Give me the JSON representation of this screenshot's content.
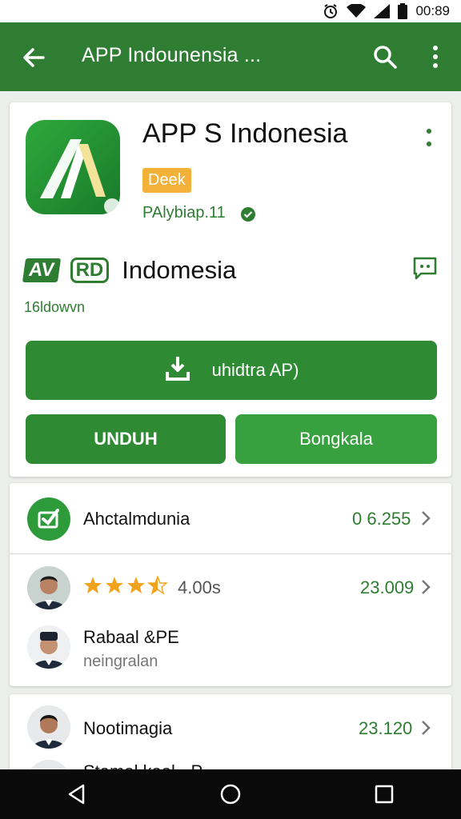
{
  "status_bar": {
    "time": "00:89",
    "icons": [
      "alarm-icon",
      "wifi-icon",
      "signal-icon",
      "battery-icon"
    ]
  },
  "toolbar": {
    "title": "APP Indounensia ...",
    "icons": [
      "back-arrow-icon",
      "search-icon",
      "more-vert-icon"
    ],
    "color": "#2f7d32"
  },
  "app": {
    "name": "APP S Indonesia",
    "badge": "Deek",
    "publisher": "PAlybiap.11",
    "brand_logo_a": "AV",
    "brand_logo_rd": "RD",
    "brand_name": "Indomesia",
    "downloads": "16ldowvn",
    "install_button": "uhidtra AP)",
    "unduh_button": "UNDUH",
    "bongkar_button": "Bongkala"
  },
  "info_rows": [
    {
      "label": "Ahctalmdunia",
      "value": "0 6.255"
    },
    {
      "rating": 3.5,
      "rating_text": "4.00s",
      "value": "23.009"
    },
    {
      "label": "Rabaal &PE",
      "sub": "neingralan"
    }
  ],
  "more_rows": [
    {
      "label": "Nootimagia",
      "value": "23.120"
    },
    {
      "label": "Stamal kaal - P"
    }
  ],
  "colors": {
    "accent": "#2e7d32",
    "button": "#2e8b34",
    "badge": "#f3b13a",
    "star": "#f3a21b"
  },
  "navigation": {
    "buttons": [
      "back-triangle-icon",
      "home-circle-icon",
      "recents-square-icon"
    ]
  }
}
